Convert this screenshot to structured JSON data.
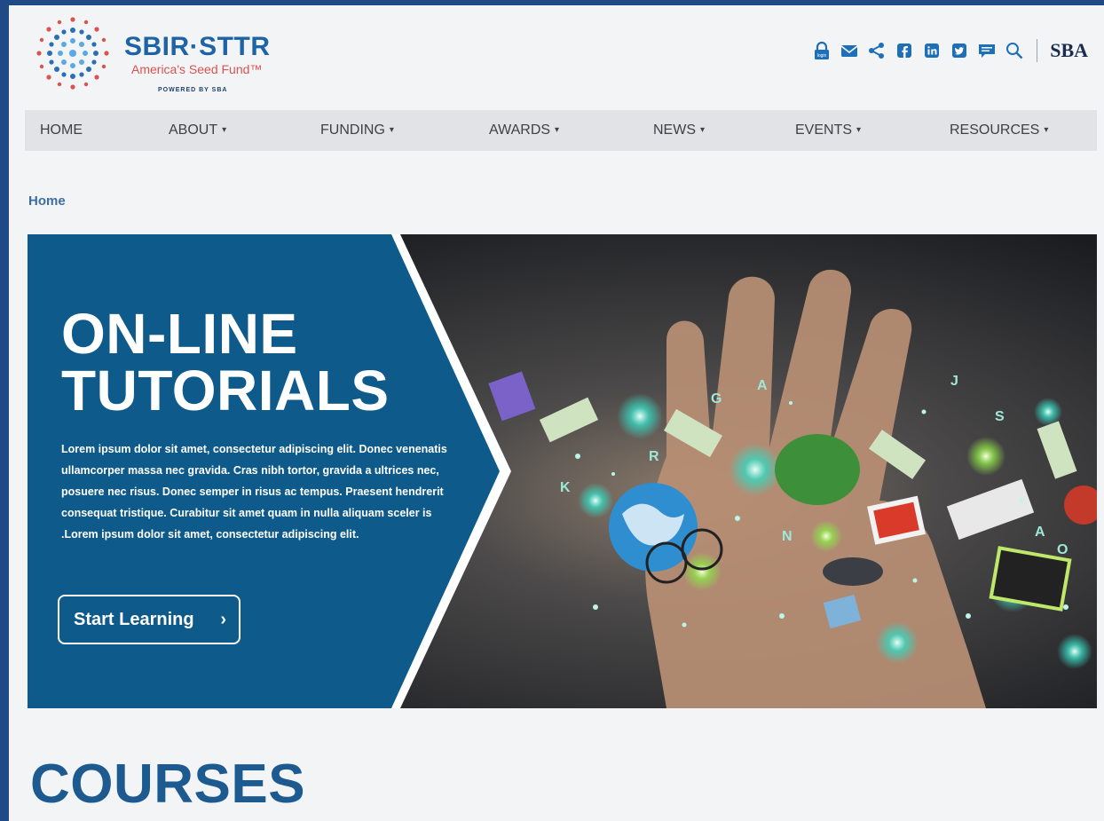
{
  "header": {
    "logo_title": "SBIR·STTR",
    "logo_subtitle": "America's Seed Fund™",
    "logo_powered": "POWERED BY SBA",
    "agency_mark": "SBA",
    "icons": [
      "login-icon",
      "email-icon",
      "share-icon",
      "facebook-icon",
      "linkedin-icon",
      "twitter-icon",
      "chat-icon",
      "search-icon"
    ],
    "login_text": "login"
  },
  "nav": {
    "items": [
      {
        "label": "HOME"
      },
      {
        "label": "ABOUT"
      },
      {
        "label": "FUNDING"
      },
      {
        "label": "AWARDS"
      },
      {
        "label": "NEWS"
      },
      {
        "label": "EVENTS"
      },
      {
        "label": "RESOURCES"
      }
    ]
  },
  "breadcrumb": "Home",
  "hero": {
    "title": "ON-LINE TUTORIALS",
    "body": "Lorem ipsum dolor sit amet, consectetur adipiscing elit. Donec venenatis ullamcorper massa nec gravida. Cras nibh tortor, gravida a ultrices nec, posuere nec risus. Donec semper in risus ac tempus. Praesent hendrerit consequat tristique. Curabitur sit amet quam in nulla aliquam sceler is .Lorem ipsum dolor sit amet, consectetur adipiscing elit.",
    "button_label": "Start Learning"
  },
  "section_title": "COURSES",
  "colors": {
    "brand_blue": "#0f5a8c",
    "accent_red": "#d9534f",
    "frame": "#1f4a86"
  }
}
